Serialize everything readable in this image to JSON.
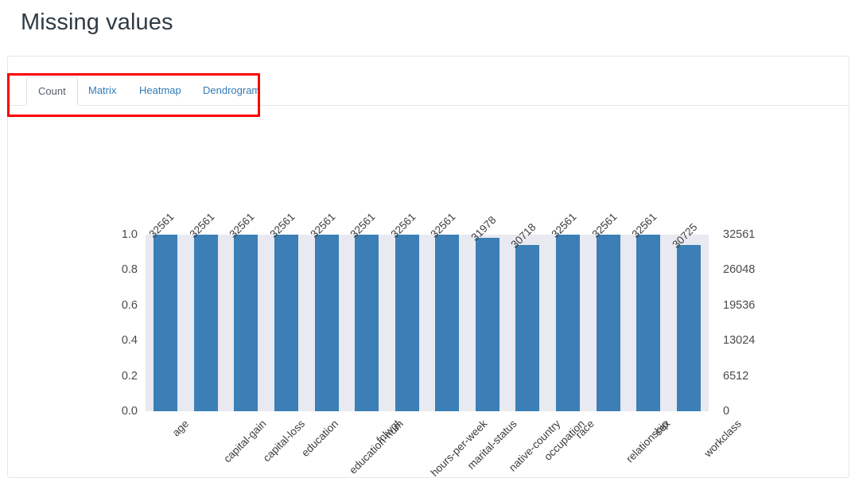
{
  "page_title": "Missing values",
  "tabs": [
    {
      "label": "Count",
      "active": true
    },
    {
      "label": "Matrix",
      "active": false
    },
    {
      "label": "Heatmap",
      "active": false
    },
    {
      "label": "Dendrogram",
      "active": false
    }
  ],
  "annotation": {
    "name": "red-highlight-rectangle",
    "color": "#fe0000"
  },
  "colors": {
    "bar": "#3b7fb6",
    "plot_background": "#e9e9f1",
    "link": "#337ab7",
    "panel_border": "#e7e7ec"
  },
  "chart_data": {
    "type": "bar",
    "title": "",
    "xlabel": "",
    "ylabel": "",
    "grid": false,
    "legend": null,
    "categories": [
      "age",
      "capital-gain",
      "capital-loss",
      "education",
      "education-num",
      "fnlwgt",
      "hours-per-week",
      "marital-status",
      "native-country",
      "occupation",
      "race",
      "relationship",
      "sex",
      "workclass"
    ],
    "values": [
      32561,
      32561,
      32561,
      32561,
      32561,
      32561,
      32561,
      32561,
      31978,
      30718,
      32561,
      32561,
      32561,
      30725
    ],
    "bar_top_labels": [
      "32561",
      "32561",
      "32561",
      "32561",
      "32561",
      "32561",
      "32561",
      "32561",
      "31978",
      "30718",
      "32561",
      "32561",
      "32561",
      "30725"
    ],
    "total_rows": 32561,
    "left_axis": {
      "ticks": [
        0.0,
        0.2,
        0.4,
        0.6,
        0.8,
        1.0
      ],
      "tick_labels": [
        "0.0",
        "0.2",
        "0.4",
        "0.6",
        "0.8",
        "1.0"
      ],
      "ylim": [
        0,
        1
      ]
    },
    "right_axis": {
      "ticks": [
        0,
        6512,
        13024,
        19536,
        26048,
        32561
      ],
      "tick_labels": [
        "0",
        "6512",
        "13024",
        "19536",
        "26048",
        "32561"
      ],
      "ylim": [
        0,
        32561
      ]
    }
  }
}
